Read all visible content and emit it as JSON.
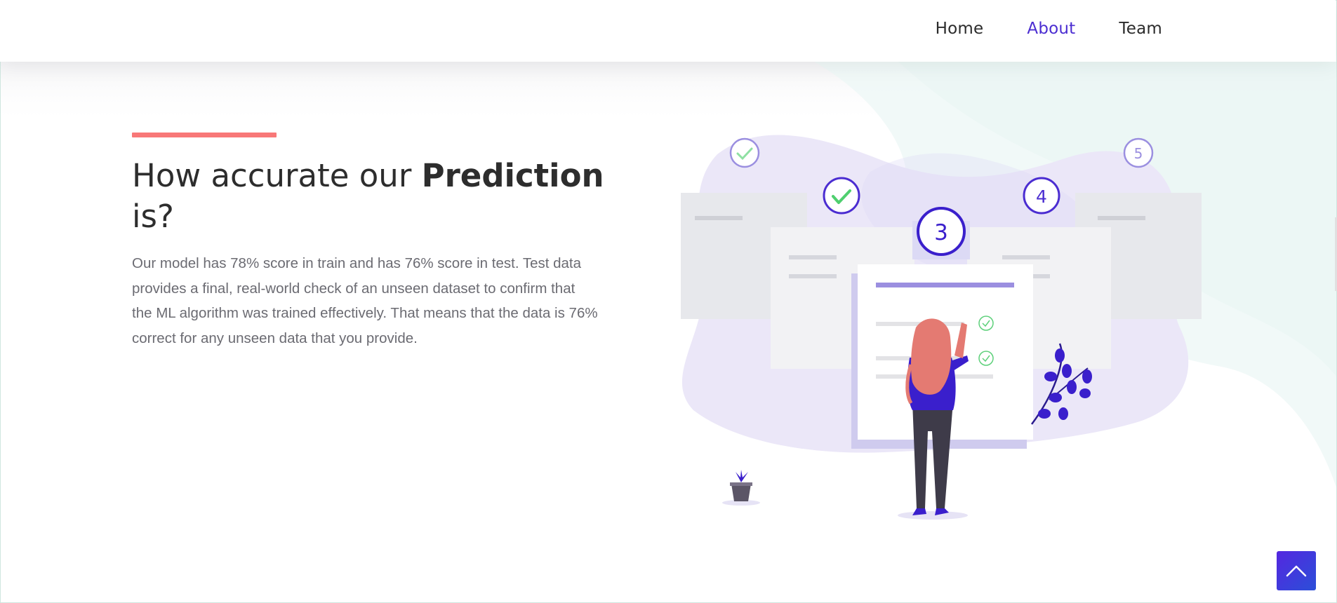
{
  "nav": {
    "items": [
      {
        "label": "Home",
        "active": false
      },
      {
        "label": "About",
        "active": true
      },
      {
        "label": "Team",
        "active": false
      }
    ]
  },
  "hero": {
    "heading_prefix": "How accurate our ",
    "heading_bold": "Prediction",
    "heading_suffix": " is?",
    "body": "Our model has 78% score in train and has 76% score in test. Test data provides a final, real-world check of an unseen dataset to confirm that the ML algorithm was trained effectively. That means that the data is 76% correct for any unseen data that you provide."
  },
  "illustration": {
    "step_numbers": [
      "3",
      "4",
      "5"
    ]
  },
  "colors": {
    "accent": "#f87878",
    "brand": "#4b2dd1",
    "text_dark": "#2d2d2d",
    "text_body": "#6b6b72"
  },
  "icons": {
    "scroll_top": "chevron-up-icon"
  }
}
